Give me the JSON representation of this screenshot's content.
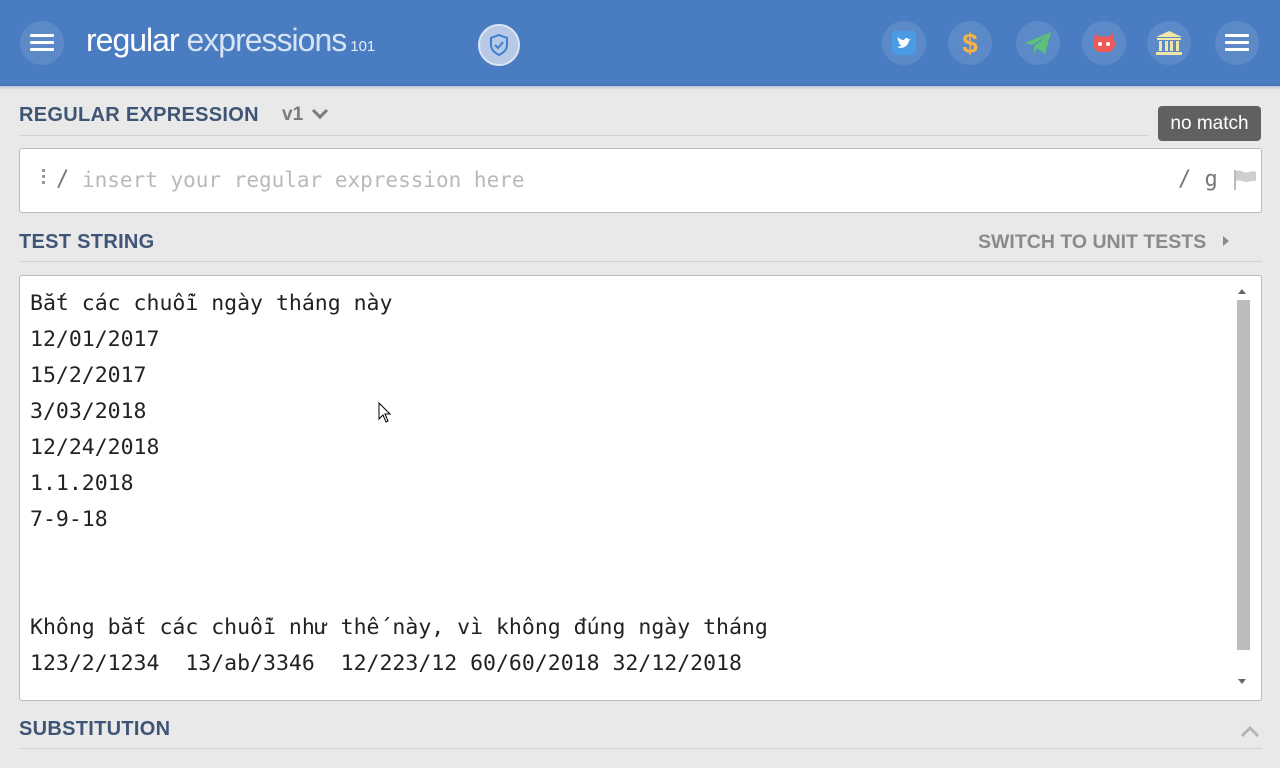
{
  "header": {
    "logo_main": "regular",
    "logo_secondary": "expressions",
    "logo_sub": "101",
    "bg_color": "#4a7cc2",
    "icons": [
      "menu-icon",
      "shield-icon",
      "twitter-icon",
      "dollar-icon",
      "paper-plane-icon",
      "github-icon",
      "bank-icon",
      "menu-icon"
    ]
  },
  "regex_section": {
    "title": "REGULAR EXPRESSION",
    "version": "v1",
    "status_badge": "no match",
    "open_delimiter": "/",
    "placeholder": "insert your regular expression here",
    "close_delimiter": "/",
    "flags": "g"
  },
  "test_section": {
    "title": "TEST STRING",
    "switch_link": "SWITCH TO UNIT TESTS",
    "lines": [
      "Bắt các chuỗi ngày tháng này",
      "12/01/2017",
      "15/2/2017",
      "3/03/2018",
      "12/24/2018",
      "1.1.2018",
      "7-9-18",
      "",
      "",
      "Không bắt các chuỗi như thế này, vì không đúng ngày tháng",
      "123/2/1234  13/ab/3346  12/223/12 60/60/2018 32/12/2018"
    ]
  },
  "substitution_section": {
    "title": "SUBSTITUTION"
  }
}
